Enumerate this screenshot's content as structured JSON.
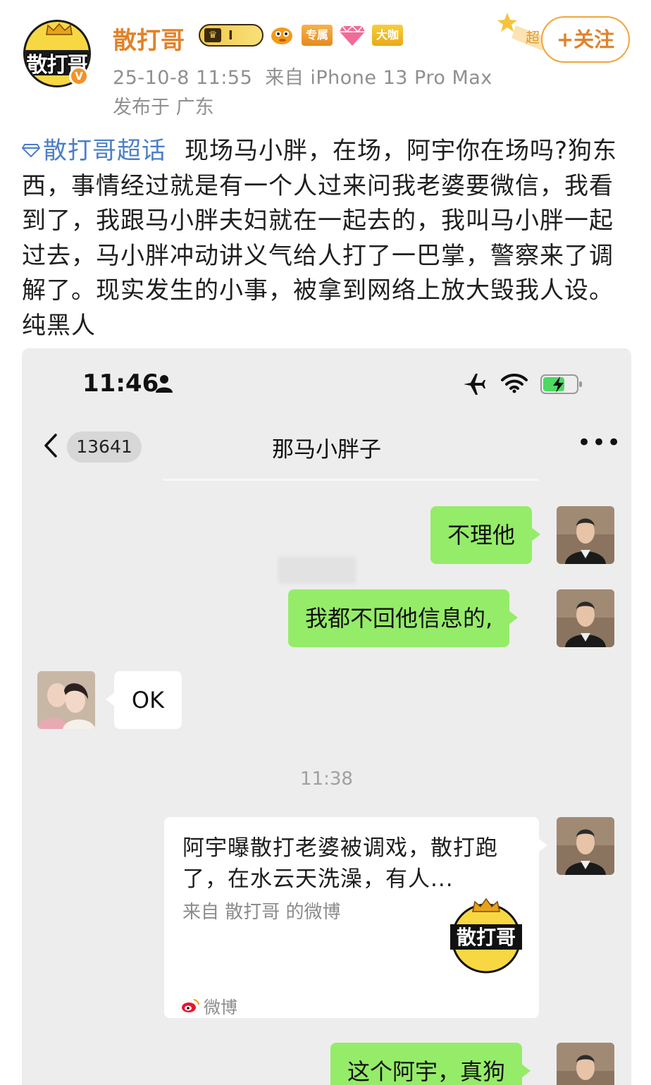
{
  "post": {
    "author": "散打哥",
    "avatar_text": "散打哥",
    "verified_mark": "V",
    "level_badge": "I",
    "badge_exclusive": "专属",
    "badge_dakai": "大咖",
    "follow_label": "+关注",
    "follow_deco_text": "超",
    "date": "25-10-8 11:55",
    "source": "来自 iPhone 13 Pro Max",
    "location": "发布于 广东",
    "topic": "散打哥超话",
    "body": "现场马小胖，在场，阿宇你在场吗?狗东西，事情经过就是有一个人过来问我老婆要微信，我看到了，我跟马小胖夫妇就在一起去的，我叫马小胖一起过去，马小胖冲动讲义气给人打了一巴掌，警察来了调解了。现实发生的小事，被拿到网络上放大毁我人设。纯黑人"
  },
  "screenshot": {
    "status_time": "11:46",
    "back_count": "13641",
    "chat_title": "那马小胖子",
    "more": "•••",
    "messages": [
      {
        "side": "right",
        "text": "不理他"
      },
      {
        "side": "right",
        "text": "我都不回他信息的,"
      },
      {
        "side": "left",
        "text": "OK"
      },
      {
        "side": "right",
        "text": "这个阿宇，真狗"
      }
    ],
    "divider_time": "11:38",
    "share_card": {
      "title": "阿宇曝散打老婆被调戏，散打跑了，在水云天洗澡，有人...",
      "source": "来自 散打哥 的微博",
      "logo_text": "散打哥",
      "footer": "微博"
    }
  },
  "colors": {
    "brand_orange": "#e0832a",
    "topic_blue": "#4b7fc6",
    "wechat_green": "#95ec69",
    "chat_bg": "#ededed"
  },
  "icons": [
    "crown-icon",
    "verified-icon",
    "fish-icon",
    "gem-icon",
    "diamond-icon",
    "person-icon",
    "airplane-icon",
    "wifi-icon",
    "battery-icon",
    "back-chevron-icon",
    "weibo-icon"
  ]
}
